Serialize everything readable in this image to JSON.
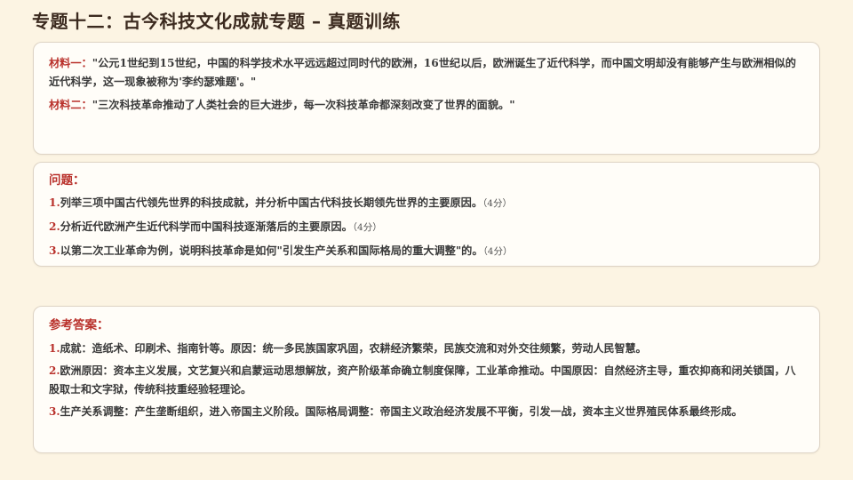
{
  "title": "专题十二：古今科技文化成就专题 – 真题训练",
  "materials": [
    {
      "label": "材料一：",
      "text": "\"公元1世纪到15世纪，中国的科学技术水平远远超过同时代的欧洲，16世纪以后，欧洲诞生了近代科学，而中国文明却没有能够产生与欧洲相似的近代科学，这一现象被称为'李约瑟难题'。\""
    },
    {
      "label": "材料二：",
      "text": "\"三次科技革命推动了人类社会的巨大进步，每一次科技革命都深刻改变了世界的面貌。\""
    }
  ],
  "questions": {
    "heading": "问题：",
    "items": [
      {
        "num": "1.",
        "text": "列举三项中国古代领先世界的科技成就，并分析中国古代科技长期领先世界的主要原因。",
        "score": "（4分）"
      },
      {
        "num": "2.",
        "text": "分析近代欧洲产生近代科学而中国科技逐渐落后的主要原因。",
        "score": "（4分）"
      },
      {
        "num": "3.",
        "text": "以第二次工业革命为例，说明科技革命是如何\"引发生产关系和国际格局的重大调整\"的。",
        "score": "（4分）"
      }
    ]
  },
  "answers": {
    "heading": "参考答案：",
    "items": [
      {
        "num": "1.",
        "text": "成就：造纸术、印刷术、指南针等。原因：统一多民族国家巩固，农耕经济繁荣，民族交流和对外交往频繁，劳动人民智慧。"
      },
      {
        "num": "2.",
        "text": "欧洲原因：资本主义发展，文艺复兴和启蒙运动思想解放，资产阶级革命确立制度保障，工业革命推动。中国原因：自然经济主导，重农抑商和闭关锁国，八股取士和文字狱，传统科技重经验轻理论。"
      },
      {
        "num": "3.",
        "text": "生产关系调整：产生垄断组织，进入帝国主义阶段。国际格局调整：帝国主义政治经济发展不平衡，引发一战，资本主义世界殖民体系最终形成。"
      }
    ]
  }
}
